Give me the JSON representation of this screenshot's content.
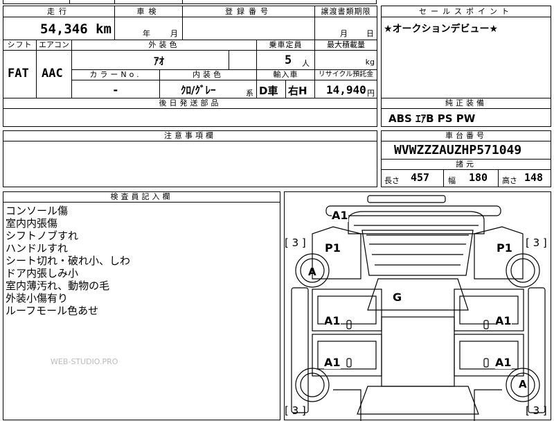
{
  "top_partial": "",
  "mileage": {
    "label": "走行",
    "value": "54,346",
    "unit": "km"
  },
  "inspection": {
    "label": "車検",
    "year_unit": "年",
    "month_unit": "月"
  },
  "registration": {
    "label": "登録番号",
    "value": ""
  },
  "transfer": {
    "label": "譲渡書類期限",
    "month_unit": "月",
    "day_unit": "日"
  },
  "sales_point": {
    "label": "セールスポイント",
    "text": "★オークションデビュー★"
  },
  "shift": {
    "label": "シフト",
    "value": "FAT"
  },
  "aircon": {
    "label": "エアコン",
    "value": "AAC"
  },
  "exterior": {
    "label": "外装色",
    "value": "ｱｵ"
  },
  "capacity": {
    "label": "乗車定員",
    "value": "5",
    "unit": "人"
  },
  "max_load": {
    "label": "最大積載量",
    "unit": "kg"
  },
  "color_no": {
    "label": "カラーNo.",
    "value": "-"
  },
  "interior": {
    "label": "内装色",
    "value": "ｸﾛ/ｸﾞﾚｰ",
    "suffix": "系"
  },
  "import": {
    "label": "輸入車",
    "value": "D車",
    "steering": "右H"
  },
  "recycle": {
    "label": "リサイクル預託金",
    "value": "14,940",
    "unit": "円"
  },
  "later_parts": {
    "label": "後日発送部品",
    "value": ""
  },
  "equipment": {
    "label": "純正装備",
    "value": "ABS ｴｱB PS PW"
  },
  "notes_field": {
    "label": "注意事項欄",
    "value": ""
  },
  "chassis": {
    "label": "車台番号",
    "value": "WVWZZZAUZHP571049"
  },
  "dimensions": {
    "label": "諸元",
    "length_label": "長さ",
    "length": "457",
    "width_label": "幅",
    "width": "180",
    "height_label": "高さ",
    "height": "148"
  },
  "inspector": {
    "label": "検査員記入欄",
    "lines": [
      "コンソール傷",
      "室内内張傷",
      "シフトノブすれ",
      "ハンドルすれ",
      "シート切れ・破れ小、しわ",
      "ドア内張しみ小",
      "室内薄汚れ、動物の毛",
      "外装小傷有り",
      "ルーフモール色あせ"
    ]
  },
  "watermark": "WEB-STUDIO.PRO",
  "diagram": {
    "marks": {
      "a1_top": "A1",
      "p1_left": "P1",
      "p1_right": "P1",
      "a_left": "A",
      "a_right": "A",
      "g": "G",
      "a1_ml": "A1",
      "a1_mr": "A1",
      "a1_ll": "A1",
      "a1_lr": "A1"
    },
    "tire_tl": "[ 3 ]",
    "tire_tr": "[ 3 ]",
    "tire_bl": "[ 3 ]",
    "tire_br": "[ 3 ]"
  }
}
